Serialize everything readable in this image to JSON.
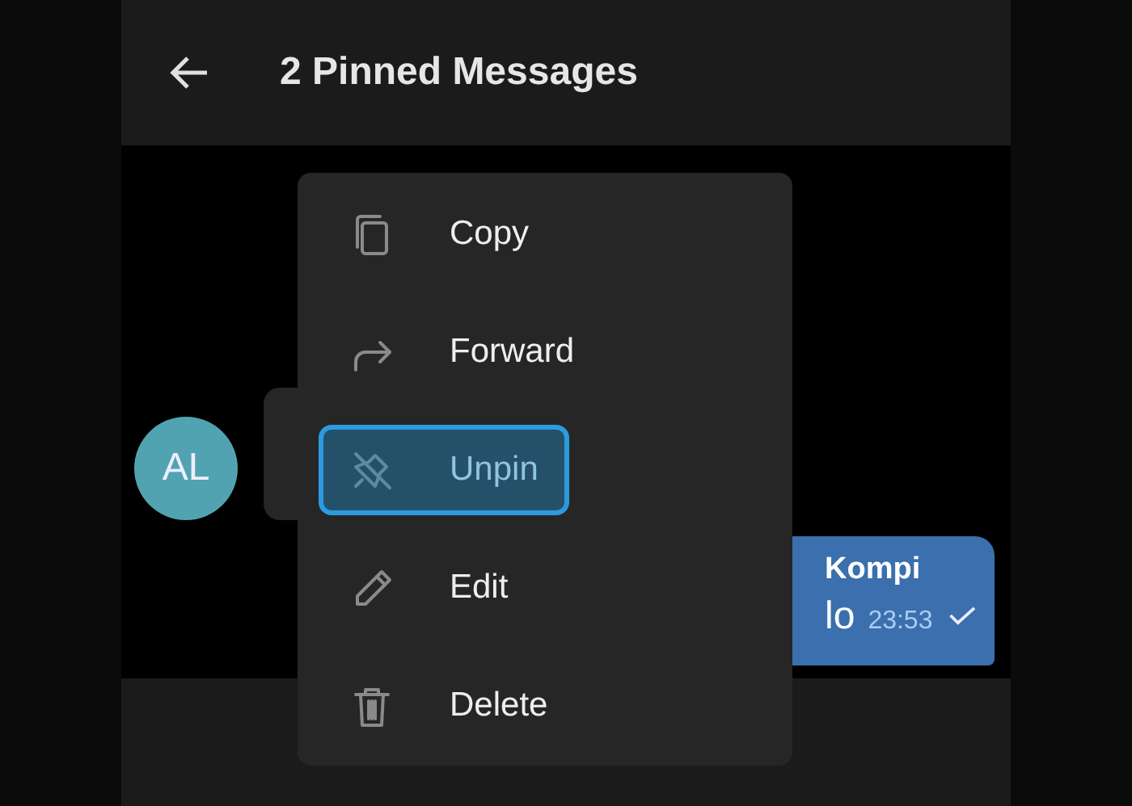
{
  "header": {
    "title": "2 Pinned Messages"
  },
  "messages": [
    {
      "kind": "incoming",
      "avatar": "AL"
    },
    {
      "kind": "outgoing",
      "sender": "Kompi",
      "text": "lo",
      "time": "23:53",
      "read": true
    }
  ],
  "context_menu": {
    "items": [
      {
        "kind": "copy",
        "label": "Copy",
        "selected": false
      },
      {
        "kind": "forward",
        "label": "Forward",
        "selected": false
      },
      {
        "kind": "unpin",
        "label": "Unpin",
        "selected": true
      },
      {
        "kind": "edit",
        "label": "Edit",
        "selected": false
      },
      {
        "kind": "delete",
        "label": "Delete",
        "selected": false
      }
    ]
  }
}
